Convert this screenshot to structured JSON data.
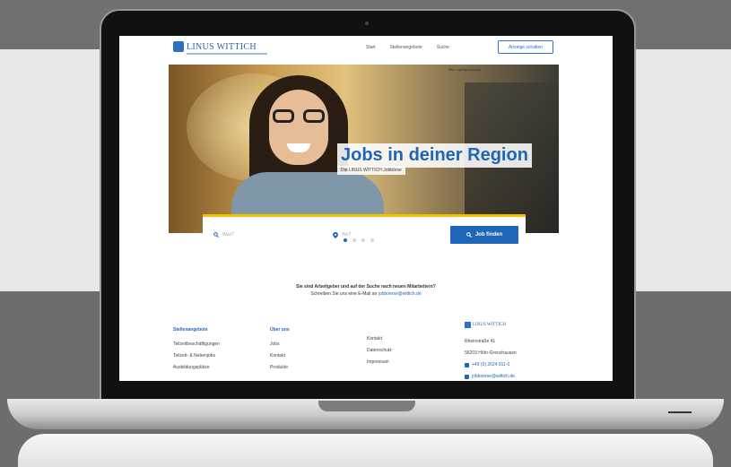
{
  "site": {
    "logo_text": "LINUS WITTICH",
    "nav": [
      "Start",
      "Stellenangebote",
      "Suche"
    ],
    "login_label": "Anzeige schalten",
    "hero": {
      "small_text": "Bild: Laptop Mockup",
      "title": "Jobs in deiner Region",
      "subtitle": "Die LINUS WITTICH Jobbörse",
      "what_placeholder": "Was?",
      "where_placeholder": "Wo?",
      "search_label": "Job finden",
      "slide_count": 4,
      "active_slide": 1
    },
    "cta": {
      "line1": "Sie sind Arbeitgeber und auf der Suche nach neuen Mitarbeitern?",
      "line2_prefix": "Schreiben Sie uns eine E-Mail an",
      "email": "jobboerse@wittich.de"
    },
    "footer": {
      "col1": {
        "head": "Stellenangebote",
        "items": [
          "Teilzeitbeschäftigungen",
          "Teilzeit- & Nebenjobs",
          "Ausbildungsplätze"
        ]
      },
      "col2": {
        "head": "Über uns",
        "items": [
          "Jobs",
          "Kontakt",
          "Produkte"
        ]
      },
      "col3": {
        "items": [
          "Kontakt",
          "Datenschutz",
          "Impressum"
        ]
      },
      "contact": {
        "logo_text": "LINUS WITTICH",
        "street": "Rheinstraße 41",
        "city": "56203 Höhr-Grenzhausen",
        "phone": "+49 (0) 2624 911-0",
        "email": "jobboerse@wittich.de"
      }
    }
  },
  "colors": {
    "brand": "#1f66b8",
    "accent": "#f2c100"
  }
}
